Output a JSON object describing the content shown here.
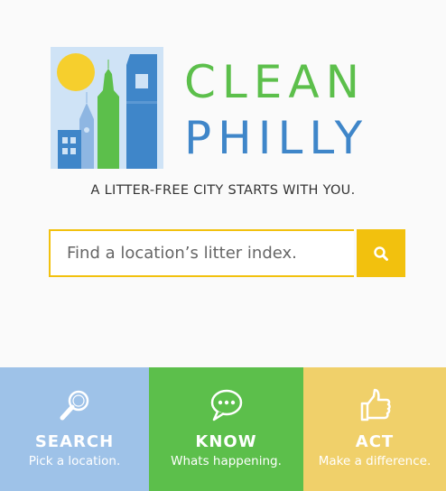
{
  "brand": {
    "line1": "CLEAN",
    "line2": "PHILLY"
  },
  "tagline": "A LITTER-FREE CITY STARTS WITH  YOU.",
  "search": {
    "placeholder": "Find a location’s litter index.",
    "button_icon": "search-icon"
  },
  "actions": [
    {
      "title": "SEARCH",
      "subtitle": "Pick a location.",
      "icon": "magnifier-icon",
      "color": "#9ec2e8"
    },
    {
      "title": "KNOW",
      "subtitle": "Whats happening.",
      "icon": "chat-bubble-icon",
      "color": "#5cbf4b"
    },
    {
      "title": "ACT",
      "subtitle": "Make a difference.",
      "icon": "thumbs-up-icon",
      "color": "#f0d06a"
    }
  ],
  "colors": {
    "green": "#5cbf4b",
    "blue": "#3f86c9",
    "yellow": "#f2c10e",
    "light_blue": "#9ec2e8"
  }
}
